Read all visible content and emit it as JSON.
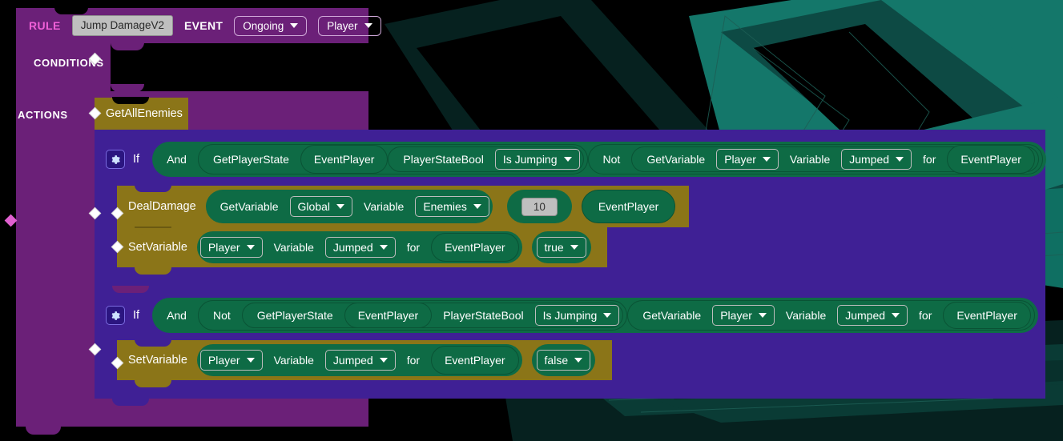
{
  "theme": {
    "rule_purple": "#6B2078",
    "action_blue": "#3F2095",
    "action_gold": "#8B7518",
    "expression_green": "#0E6B45",
    "accent_pink": "#F060D8",
    "input_grey": "#BFBFBF",
    "background_teal": "#14776A",
    "background_black": "#000000"
  },
  "rule": {
    "label": "RULE",
    "name_value": "Jump DamageV2",
    "event_label": "EVENT",
    "event_type": "Ongoing",
    "event_target": "Player",
    "conditions_label": "CONDITIONS",
    "actions_label": "ACTIONS"
  },
  "actions": [
    {
      "kind": "action",
      "name": "GetAllEnemies"
    },
    {
      "kind": "if",
      "label": "If",
      "gear_icon": "gear-icon",
      "condition": {
        "op": "And",
        "left": {
          "op": "GetPlayerState",
          "args": [
            "EventPlayer",
            "PlayerStateBool"
          ],
          "dropdown": "Is Jumping"
        },
        "right": {
          "op": "Not",
          "inner": {
            "op": "GetVariable",
            "scope": "Player",
            "variable_label": "Variable",
            "variable": "Jumped",
            "for_label": "for",
            "target": "EventPlayer"
          }
        }
      },
      "body": [
        {
          "kind": "action",
          "name": "DealDamage",
          "args": [
            {
              "op": "GetVariable",
              "scope": "Global",
              "variable_label": "Variable",
              "variable": "Enemies"
            },
            {
              "type": "number",
              "value": "10"
            },
            {
              "type": "pill",
              "value": "EventPlayer"
            }
          ]
        },
        {
          "kind": "action",
          "name": "SetVariable",
          "scope": "Player",
          "variable_label": "Variable",
          "variable": "Jumped",
          "for_label": "for",
          "target": "EventPlayer",
          "value": "true"
        }
      ]
    },
    {
      "kind": "if",
      "label": "If",
      "gear_icon": "gear-icon",
      "condition": {
        "op": "And",
        "left": {
          "op": "Not",
          "inner": {
            "op": "GetPlayerState",
            "args": [
              "EventPlayer",
              "PlayerStateBool"
            ],
            "dropdown": "Is Jumping"
          }
        },
        "right": {
          "op": "GetVariable",
          "scope": "Player",
          "variable_label": "Variable",
          "variable": "Jumped",
          "for_label": "for",
          "target": "EventPlayer"
        }
      },
      "body": [
        {
          "kind": "action",
          "name": "SetVariable",
          "scope": "Player",
          "variable_label": "Variable",
          "variable": "Jumped",
          "for_label": "for",
          "target": "EventPlayer",
          "value": "false"
        }
      ]
    }
  ]
}
